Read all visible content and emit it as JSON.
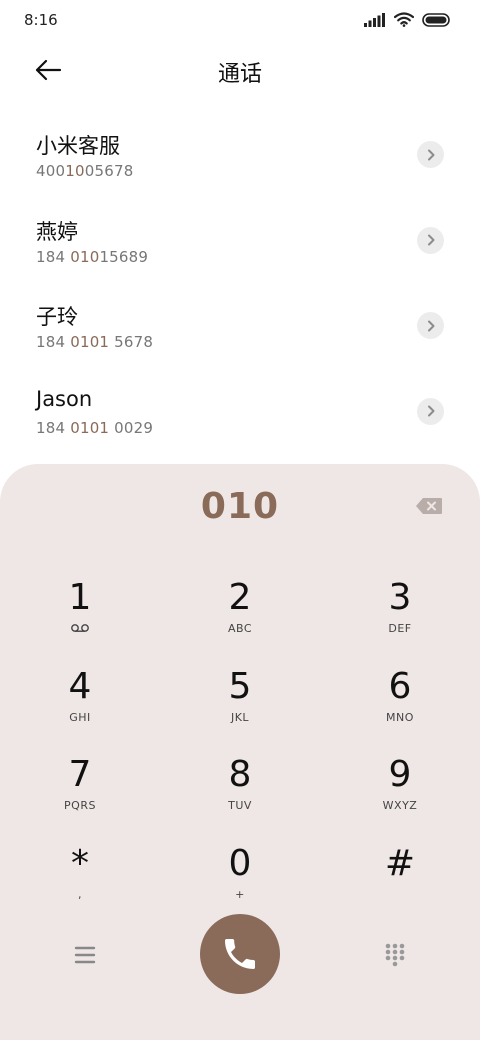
{
  "status_bar": {
    "time": "8:16"
  },
  "header": {
    "title": "通话"
  },
  "contacts": [
    {
      "name": "小米客服",
      "number_pre": "400",
      "number_match": "10",
      "number_post": "05678"
    },
    {
      "name": "燕婷",
      "number_pre": "184 ",
      "number_match": "010",
      "number_post": "15689"
    },
    {
      "name": "子玲",
      "number_pre": "184 ",
      "number_match": "0101",
      "number_post": " 5678"
    },
    {
      "name": "Jason",
      "number_pre": "184 ",
      "number_match": "0101",
      "number_post": " 0029"
    }
  ],
  "dialpad": {
    "dialed_number": "010",
    "keys": [
      {
        "digit": "1",
        "letters": ""
      },
      {
        "digit": "2",
        "letters": "ABC"
      },
      {
        "digit": "3",
        "letters": "DEF"
      },
      {
        "digit": "4",
        "letters": "GHI"
      },
      {
        "digit": "5",
        "letters": "JKL"
      },
      {
        "digit": "6",
        "letters": "MNO"
      },
      {
        "digit": "7",
        "letters": "PQRS"
      },
      {
        "digit": "8",
        "letters": "TUV"
      },
      {
        "digit": "9",
        "letters": "WXYZ"
      },
      {
        "digit": "*",
        "letters": ","
      },
      {
        "digit": "0",
        "letters": "+"
      },
      {
        "digit": "#",
        "letters": ""
      }
    ]
  },
  "icons": {
    "back": "arrow-left-icon",
    "contact_detail": "chevron-right-icon",
    "backspace": "backspace-icon",
    "voicemail": "voicemail-icon",
    "menu": "menu-icon",
    "call": "phone-icon",
    "keypad": "dialpad-icon"
  },
  "colors": {
    "accent": "#8a6a58",
    "dialpad_background": "#efe7e6"
  }
}
